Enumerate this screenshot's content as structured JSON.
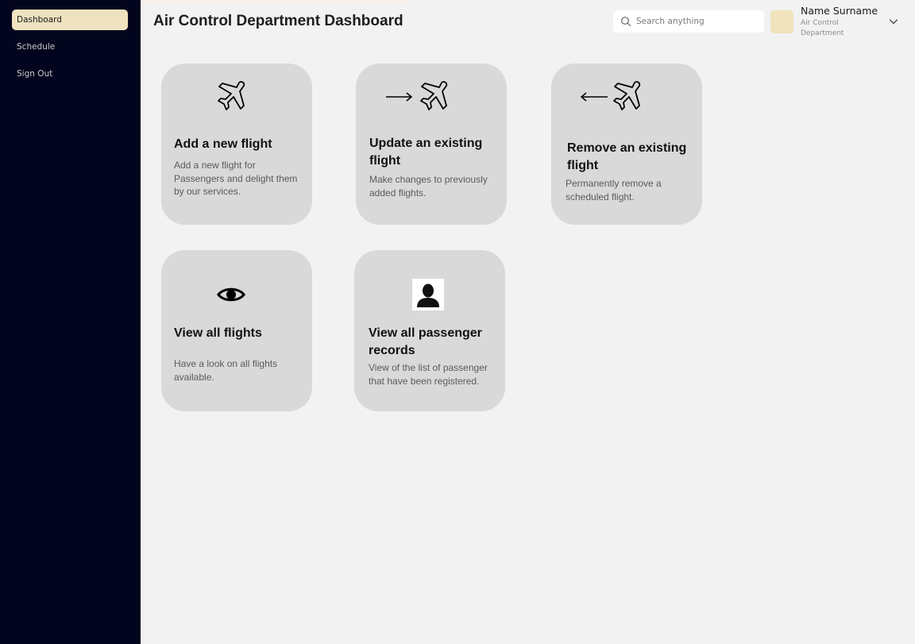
{
  "sidebar": {
    "items": [
      {
        "label": "Dashboard"
      },
      {
        "label": "Schedule"
      },
      {
        "label": "Sign Out"
      }
    ]
  },
  "header": {
    "title": "Air Control Department Dashboard",
    "search_placeholder": "Search anything",
    "user_name": "Name Surname",
    "user_department": "Air Control Department"
  },
  "cards": [
    {
      "title": "Add a new flight",
      "description": "Add a new flight for Passengers and delight them by our services.",
      "icon": "airplane-icon"
    },
    {
      "title": "Update an existing flight",
      "description": "Make changes to previously added flights.",
      "icon": "arrow-right-airplane-icon"
    },
    {
      "title": "Remove an existing flight",
      "description": "Permanently remove a scheduled flight.",
      "icon": "arrow-left-airplane-icon"
    },
    {
      "title": "View all flights",
      "description": "Have a look on all flights available.",
      "icon": "eye-icon"
    },
    {
      "title": "View all passenger records",
      "description": "View of the list of passenger that have been registered.",
      "icon": "user-icon"
    }
  ],
  "colors": {
    "sidebar_bg": "#03051e",
    "active_nav": "#efe2bf",
    "card_bg": "#d9d9d9",
    "page_bg": "#f2f2f2"
  }
}
